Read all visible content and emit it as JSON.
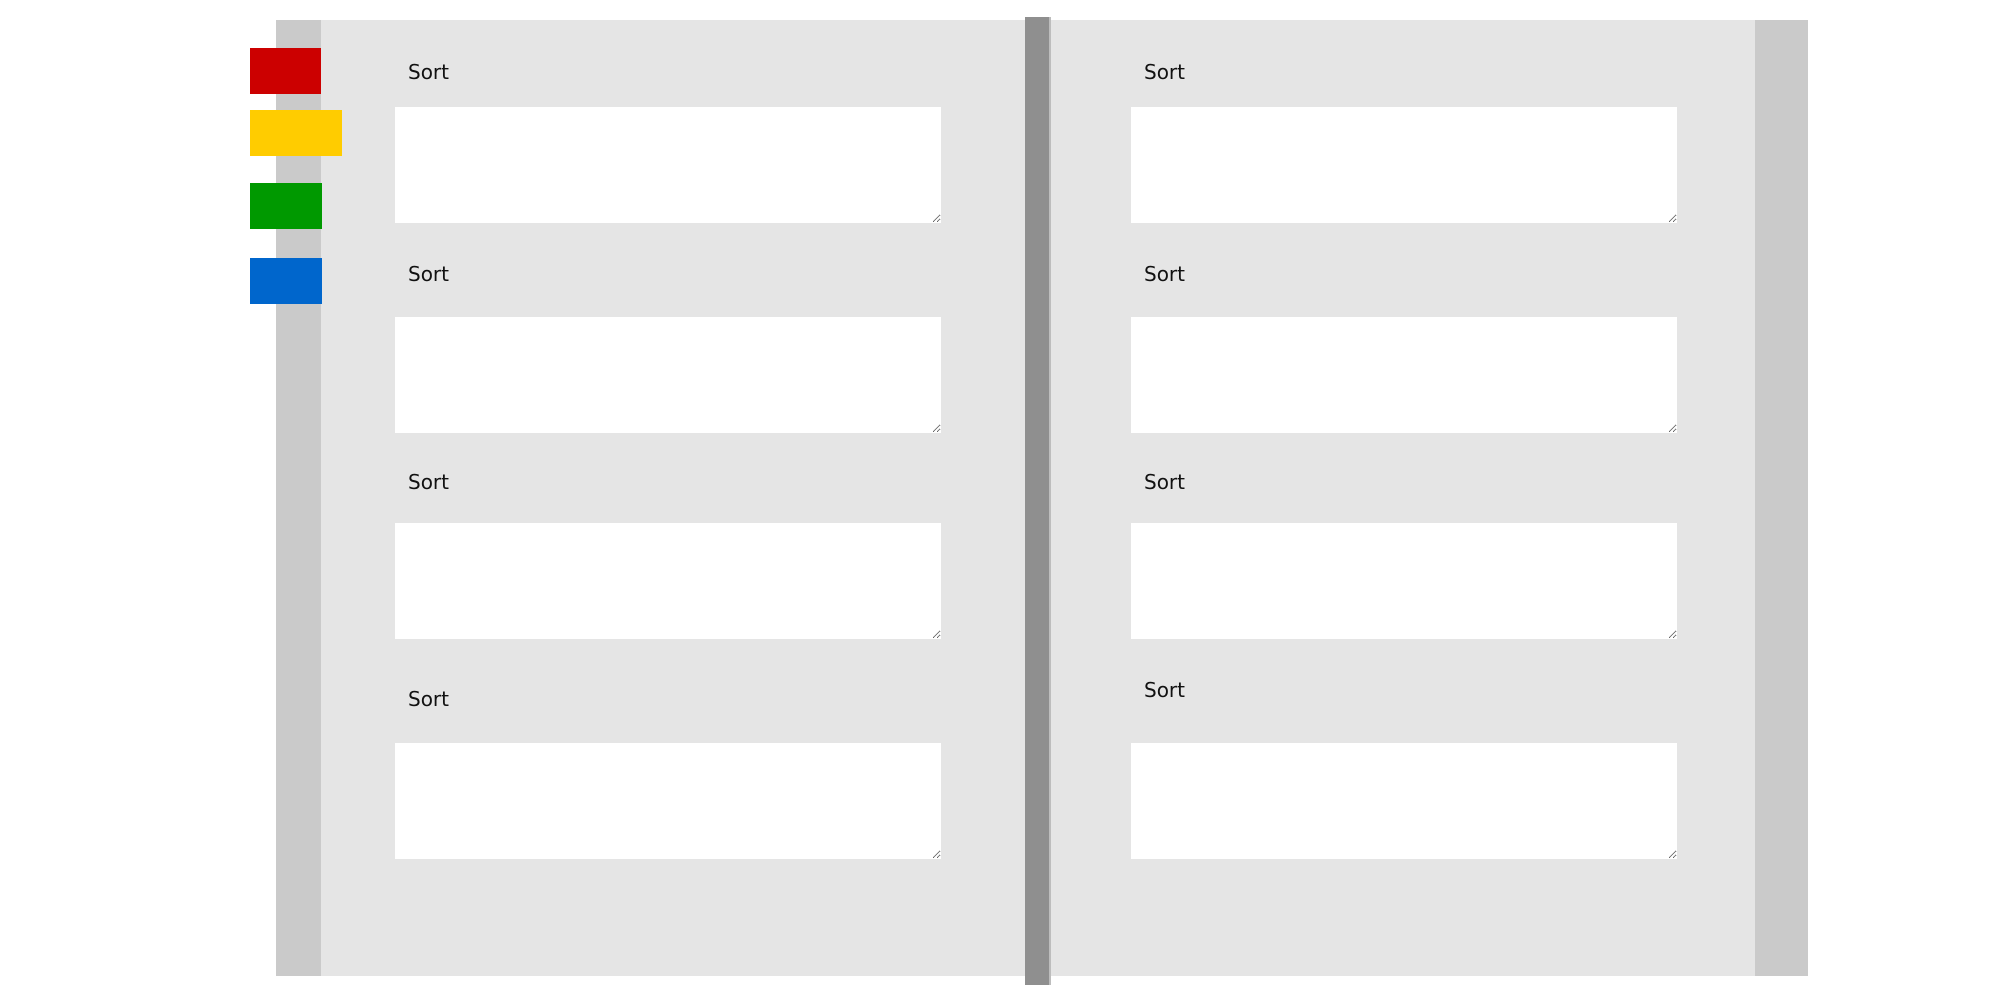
{
  "colors": {
    "page": "#e5e5e5",
    "page_edge": "#cacaca",
    "spine": "#8f8f8f",
    "field": "#ffffff"
  },
  "bookmarks": [
    {
      "name": "red",
      "color": "#cc0000"
    },
    {
      "name": "yellow",
      "color": "#ffcc00"
    },
    {
      "name": "green",
      "color": "#009900"
    },
    {
      "name": "blue",
      "color": "#0066cc"
    }
  ],
  "left_page": {
    "sections": [
      {
        "label": "Sort",
        "value": ""
      },
      {
        "label": "Sort",
        "value": ""
      },
      {
        "label": "Sort",
        "value": ""
      },
      {
        "label": "Sort",
        "value": ""
      }
    ]
  },
  "right_page": {
    "sections": [
      {
        "label": "Sort",
        "value": ""
      },
      {
        "label": "Sort",
        "value": ""
      },
      {
        "label": "Sort",
        "value": ""
      },
      {
        "label": "Sort",
        "value": ""
      }
    ]
  }
}
